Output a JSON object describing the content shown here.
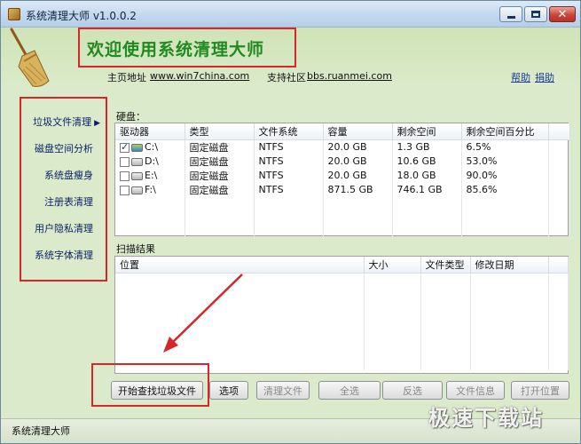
{
  "window": {
    "title": "系统清理大师 v1.0.0.2"
  },
  "header": {
    "welcome": "欢迎使用系统清理大师",
    "home_label": "主页地址",
    "home_link": "www.win7china.com",
    "support_label": "支持社区",
    "support_link": "bbs.ruanmei.com",
    "help": "帮助",
    "donate": "捐助"
  },
  "sidebar": {
    "items": [
      {
        "label": "垃圾文件清理",
        "active": true
      },
      {
        "label": "磁盘空间分析",
        "active": false
      },
      {
        "label": "系统盘瘦身",
        "active": false
      },
      {
        "label": "注册表清理",
        "active": false
      },
      {
        "label": "用户隐私清理",
        "active": false
      },
      {
        "label": "系统字体清理",
        "active": false
      }
    ]
  },
  "disks": {
    "section_label": "硬盘：",
    "columns": [
      "驱动器",
      "类型",
      "文件系统",
      "容量",
      "剩余空间",
      "剩余空间百分比"
    ],
    "rows": [
      {
        "drive": "C:\\",
        "checked": true,
        "system": true,
        "type": "固定磁盘",
        "fs": "NTFS",
        "capacity": "20.0 GB",
        "free": "1.3 GB",
        "free_pct": "6.5%"
      },
      {
        "drive": "D:\\",
        "checked": false,
        "system": false,
        "type": "固定磁盘",
        "fs": "NTFS",
        "capacity": "20.0 GB",
        "free": "10.6 GB",
        "free_pct": "53.0%"
      },
      {
        "drive": "E:\\",
        "checked": false,
        "system": false,
        "type": "固定磁盘",
        "fs": "NTFS",
        "capacity": "20.0 GB",
        "free": "18.0 GB",
        "free_pct": "90.0%"
      },
      {
        "drive": "F:\\",
        "checked": false,
        "system": false,
        "type": "固定磁盘",
        "fs": "NTFS",
        "capacity": "871.5 GB",
        "free": "746.1 GB",
        "free_pct": "85.6%"
      }
    ]
  },
  "results": {
    "section_label": "扫描结果",
    "columns": [
      "位置",
      "大小",
      "文件类型",
      "修改日期"
    ]
  },
  "buttons": {
    "start": "开始查找垃圾文件",
    "options": "选项",
    "clean": "清理文件",
    "select_all": "全选",
    "invert": "反选",
    "file_info": "文件信息",
    "open_location": "打开位置"
  },
  "statusbar": {
    "text": "系统清理大师"
  },
  "watermark": "极速下载站",
  "colors": {
    "highlight_box": "#d6262a",
    "welcome_text": "#1f8a1f",
    "panel_bg": "#dbeacb"
  },
  "icons": {
    "app": "broom-icon",
    "drive": "hard-drive-icon"
  }
}
